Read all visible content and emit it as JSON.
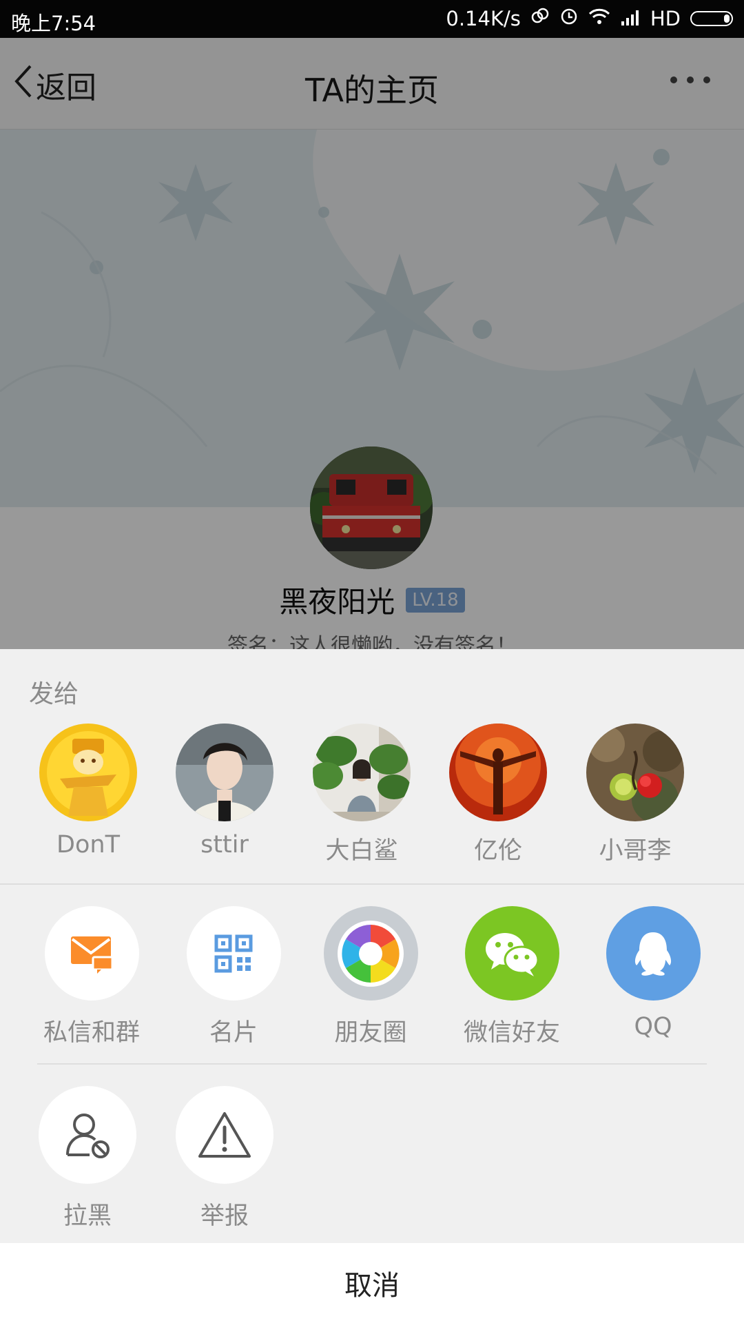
{
  "status_bar": {
    "time": "晚上7:54",
    "net_speed": "0.14K/s",
    "network": "HD"
  },
  "nav": {
    "back_label": "返回",
    "title": "TA的主页"
  },
  "profile": {
    "name": "黑夜阳光",
    "level": "LV.18",
    "signature": "签名：这人很懒哟，没有签名！"
  },
  "share_sheet": {
    "send_to_label": "发给",
    "contacts": [
      {
        "name": "DonT"
      },
      {
        "name": "sttir"
      },
      {
        "name": "大白鲨"
      },
      {
        "name": "亿伦"
      },
      {
        "name": "小哥李"
      }
    ],
    "share_actions": [
      {
        "label": "私信和群",
        "icon": "message-icon"
      },
      {
        "label": "名片",
        "icon": "qr-code-icon"
      },
      {
        "label": "朋友圈",
        "icon": "moments-icon"
      },
      {
        "label": "微信好友",
        "icon": "wechat-icon"
      },
      {
        "label": "QQ",
        "icon": "qq-icon"
      }
    ],
    "more_actions": [
      {
        "label": "拉黑",
        "icon": "block-user-icon"
      },
      {
        "label": "举报",
        "icon": "report-icon"
      }
    ],
    "cancel_label": "取消"
  },
  "colors": {
    "message_orange": "#fb8c2a",
    "qr_blue": "#5a9be0",
    "wechat_green": "#7cc623",
    "qq_blue": "#5f9fe3",
    "level_badge": "#7ba4d6"
  }
}
